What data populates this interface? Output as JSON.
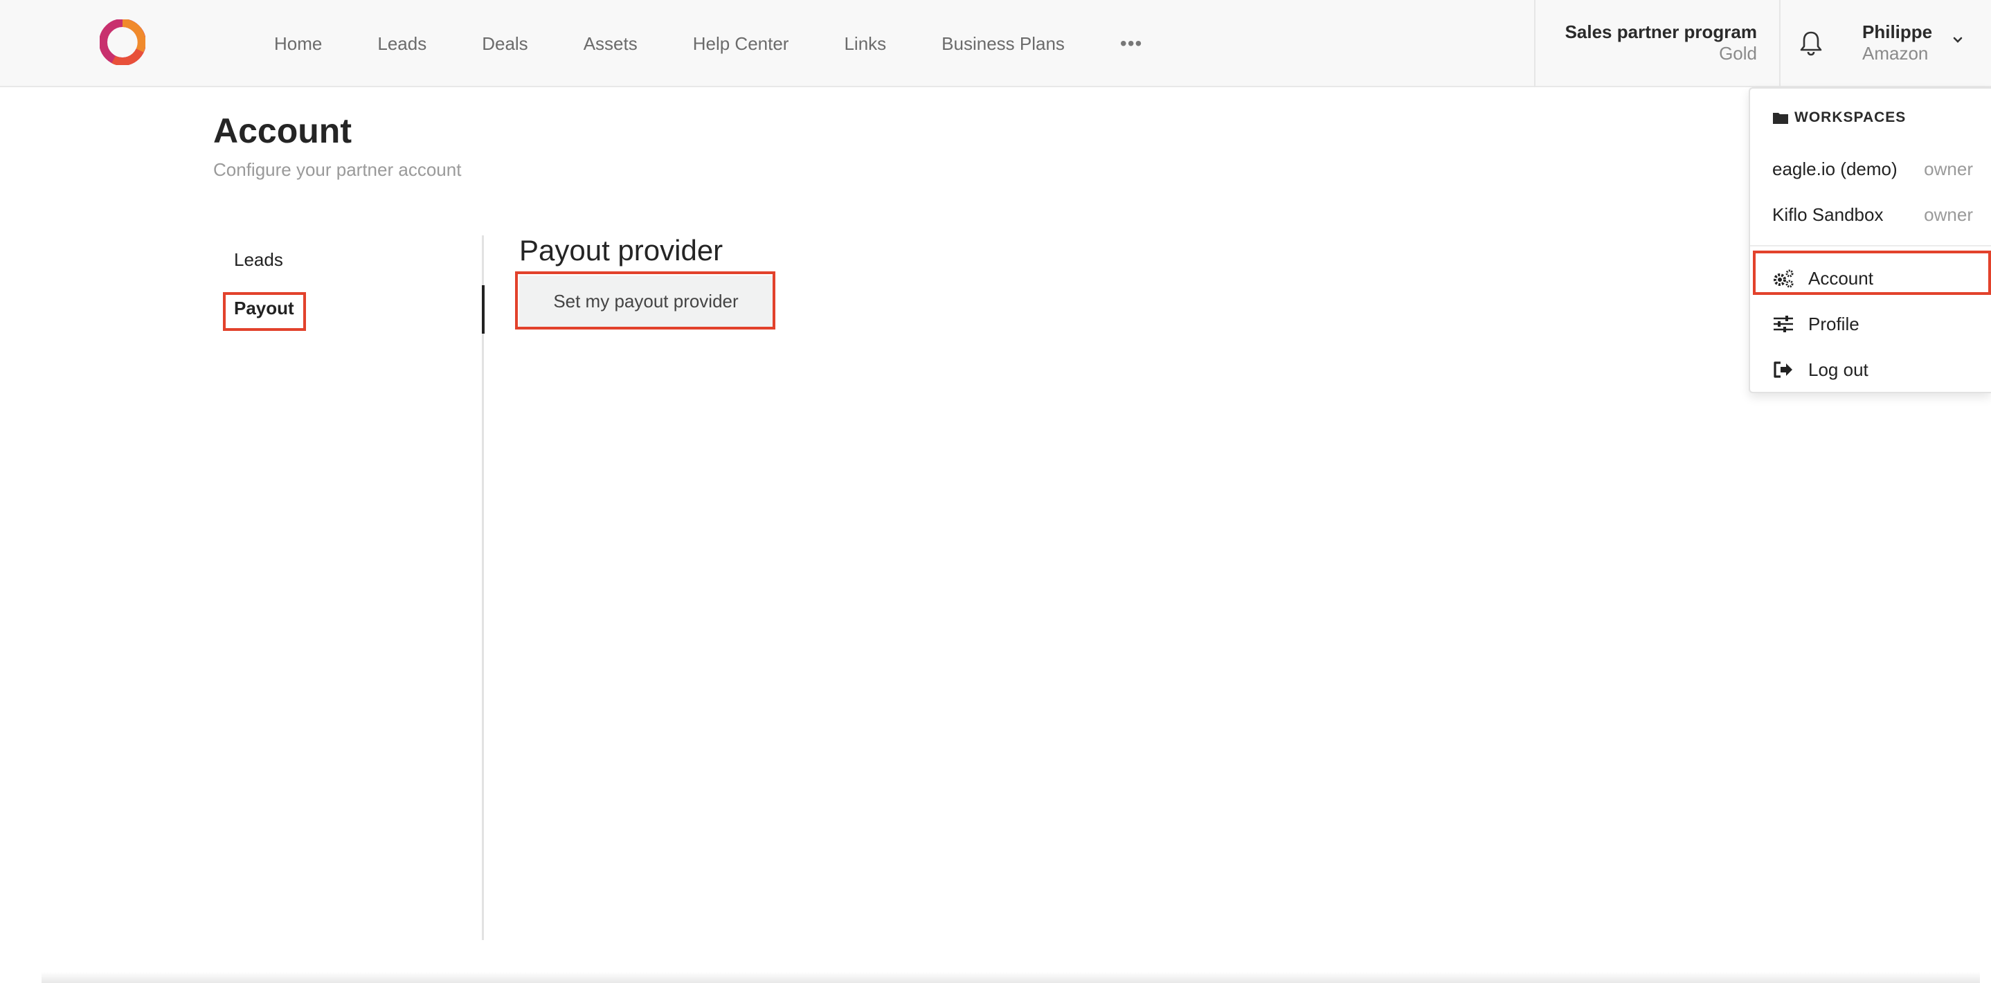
{
  "header": {
    "nav": [
      "Home",
      "Leads",
      "Deals",
      "Assets",
      "Help Center",
      "Links",
      "Business Plans"
    ],
    "more_label": "•••",
    "program": {
      "title": "Sales partner program",
      "tier": "Gold"
    },
    "user": {
      "name": "Philippe",
      "org": "Amazon"
    }
  },
  "page": {
    "title": "Account",
    "subtitle": "Configure your partner account",
    "side_menu": {
      "leads": "Leads",
      "payout": "Payout"
    },
    "section_title": "Payout provider",
    "payout_button": "Set my payout provider"
  },
  "dropdown": {
    "workspaces_heading": "WORKSPACES",
    "workspaces": [
      {
        "name": "eagle.io (demo)",
        "role": "owner"
      },
      {
        "name": "Kiflo Sandbox",
        "role": "owner"
      }
    ],
    "items": {
      "account": "Account",
      "profile": "Profile",
      "logout": "Log out"
    }
  },
  "colors": {
    "highlight": "#e2422c",
    "logo_primary": "#e8503a",
    "logo_secondary": "#c8306e"
  },
  "icons": [
    "logo-icon",
    "more-dots-icon",
    "bell-icon",
    "chevron-down-icon",
    "folder-icon",
    "gears-icon",
    "sliders-icon",
    "logout-icon"
  ]
}
